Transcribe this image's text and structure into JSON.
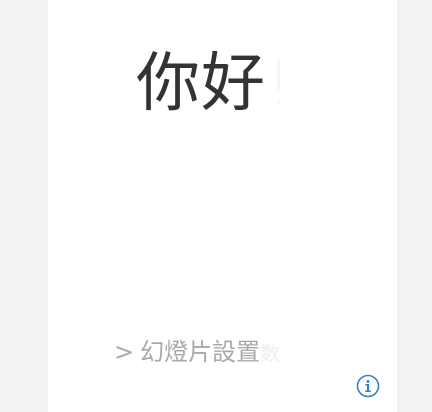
{
  "greeting": {
    "text": "你好",
    "fading_char": "!"
  },
  "setup": {
    "chevron": ">",
    "label": "幻燈片設置",
    "fading_char": "数"
  },
  "info": {
    "icon": "info-icon",
    "color": "#2f7fd6"
  }
}
